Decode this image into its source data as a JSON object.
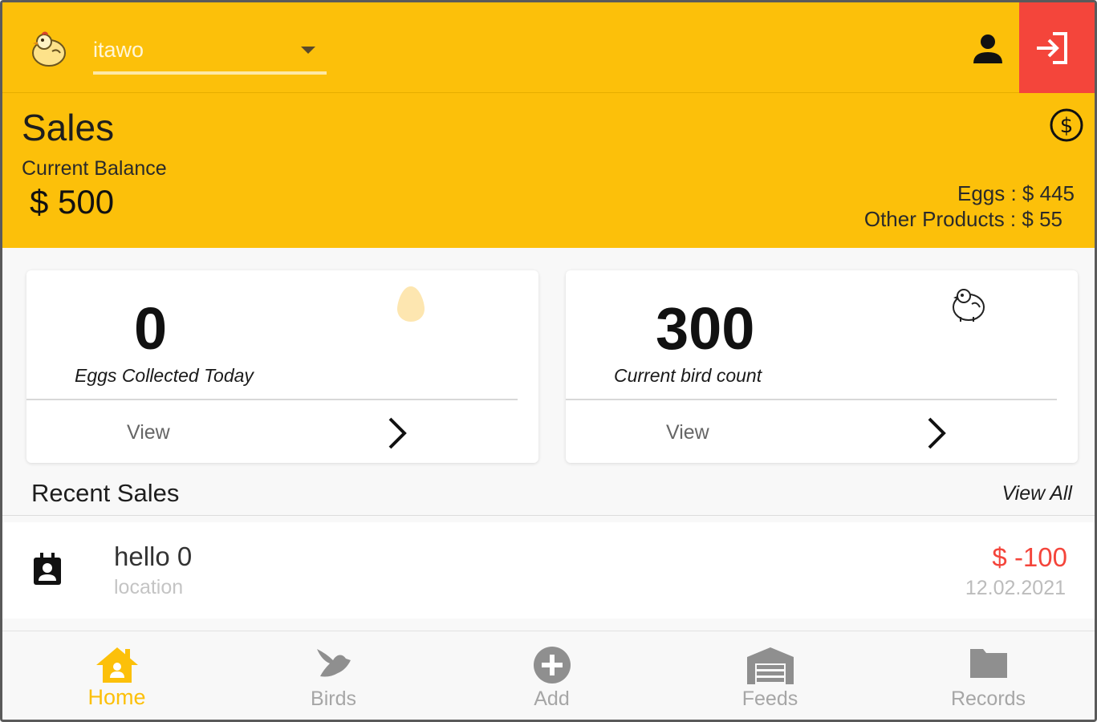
{
  "topbar": {
    "farm_name": "itawo",
    "logo_icon": "chicken-logo-icon",
    "profile_icon": "person-icon",
    "logout_icon": "logout-icon",
    "accent_color": "#fcc00a",
    "logout_color": "#f4453b"
  },
  "sales": {
    "title": "Sales",
    "balance_label": "Current Balance",
    "balance_value": "$ 500",
    "eggs_sales": "Eggs : $ 445",
    "other_sales": "Other Products : $ 55",
    "icon": "dollar-circle-icon"
  },
  "cards": {
    "eggs": {
      "value": "0",
      "caption": "Eggs Collected Today",
      "view_label": "View",
      "icon": "egg-icon"
    },
    "birds": {
      "value": "300",
      "caption": "Current bird count",
      "view_label": "View",
      "icon": "chicken-icon"
    }
  },
  "recent": {
    "title": "Recent Sales",
    "view_all": "View All",
    "items": [
      {
        "name": "hello 0",
        "location": "location",
        "amount": "$ -100",
        "date": "12.02.2021",
        "icon": "contact-icon"
      }
    ]
  },
  "bottom_nav": {
    "items": [
      {
        "label": "Home",
        "icon": "home-icon",
        "active": true
      },
      {
        "label": "Birds",
        "icon": "bird-icon",
        "active": false
      },
      {
        "label": "Add",
        "icon": "add-circle-icon",
        "active": false
      },
      {
        "label": "Feeds",
        "icon": "warehouse-icon",
        "active": false
      },
      {
        "label": "Records",
        "icon": "folder-icon",
        "active": false
      }
    ]
  }
}
